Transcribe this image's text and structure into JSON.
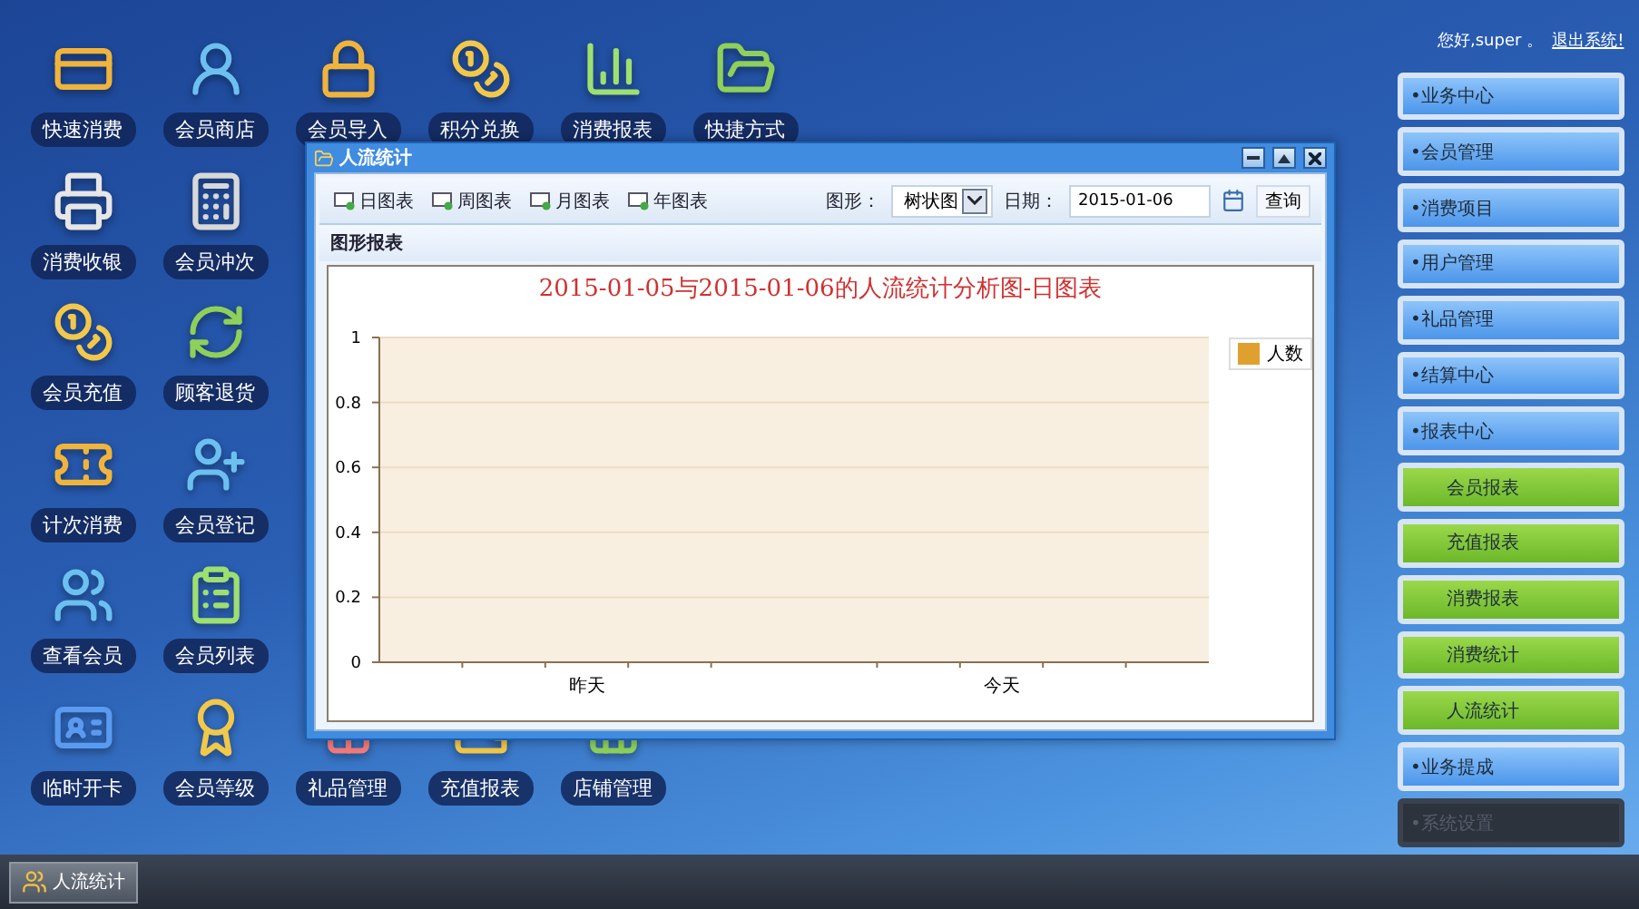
{
  "desktop": {
    "icon_rows": [
      [
        "快速消费",
        "会员商店",
        "会员导入",
        "积分兑换",
        "消费报表",
        "快捷方式"
      ],
      [
        "消费收银",
        "会员冲次"
      ],
      [
        "会员充值",
        "顾客退货"
      ],
      [
        "计次消费",
        "会员登记"
      ],
      [
        "查看会员",
        "会员列表"
      ],
      [
        "临时开卡",
        "会员等级",
        "礼品管理",
        "充值报表",
        "店铺管理"
      ]
    ]
  },
  "window": {
    "title": "人流统计",
    "toolbar": {
      "tabs": [
        "日图表",
        "周图表",
        "月图表",
        "年图表"
      ],
      "shape_label": "图形：",
      "shape_value": "树状图",
      "date_label": "日期：",
      "date_value": "2015-01-06",
      "query_button": "查询"
    },
    "section_title": "图形报表",
    "chart_data": {
      "type": "bar",
      "title": "2015-01-05与2015-01-06的人流统计分析图-日图表",
      "categories": [
        "昨天",
        "今天"
      ],
      "series": [
        {
          "name": "人数",
          "color": "#e0a030",
          "values": [
            0,
            0
          ]
        }
      ],
      "grid": true,
      "ylim": [
        0,
        1
      ],
      "yticks": [
        0,
        0.2,
        0.4,
        0.6,
        0.8,
        1
      ]
    }
  },
  "header": {
    "greeting": "您好,super 。",
    "logout_link": "退出系统!"
  },
  "menu": [
    {
      "label": "•业务中心",
      "kind": "category",
      "dimmed": false
    },
    {
      "label": "•会员管理",
      "kind": "category",
      "dimmed": false
    },
    {
      "label": "•消费项目",
      "kind": "category",
      "dimmed": false
    },
    {
      "label": "•用户管理",
      "kind": "category",
      "dimmed": false
    },
    {
      "label": "•礼品管理",
      "kind": "category",
      "dimmed": false
    },
    {
      "label": "•结算中心",
      "kind": "category",
      "dimmed": false
    },
    {
      "label": "•报表中心",
      "kind": "category",
      "dimmed": false
    },
    {
      "label": "会员报表",
      "kind": "sub",
      "dimmed": false
    },
    {
      "label": "充值报表",
      "kind": "sub",
      "dimmed": false
    },
    {
      "label": "消费报表",
      "kind": "sub",
      "dimmed": false
    },
    {
      "label": "消费统计",
      "kind": "sub",
      "dimmed": false
    },
    {
      "label": "人流统计",
      "kind": "sub",
      "dimmed": false
    },
    {
      "label": "•业务提成",
      "kind": "category",
      "dimmed": false
    },
    {
      "label": "•系统设置",
      "kind": "category",
      "dimmed": true
    }
  ],
  "taskbar": {
    "items": [
      {
        "label": "人流统计"
      }
    ]
  }
}
